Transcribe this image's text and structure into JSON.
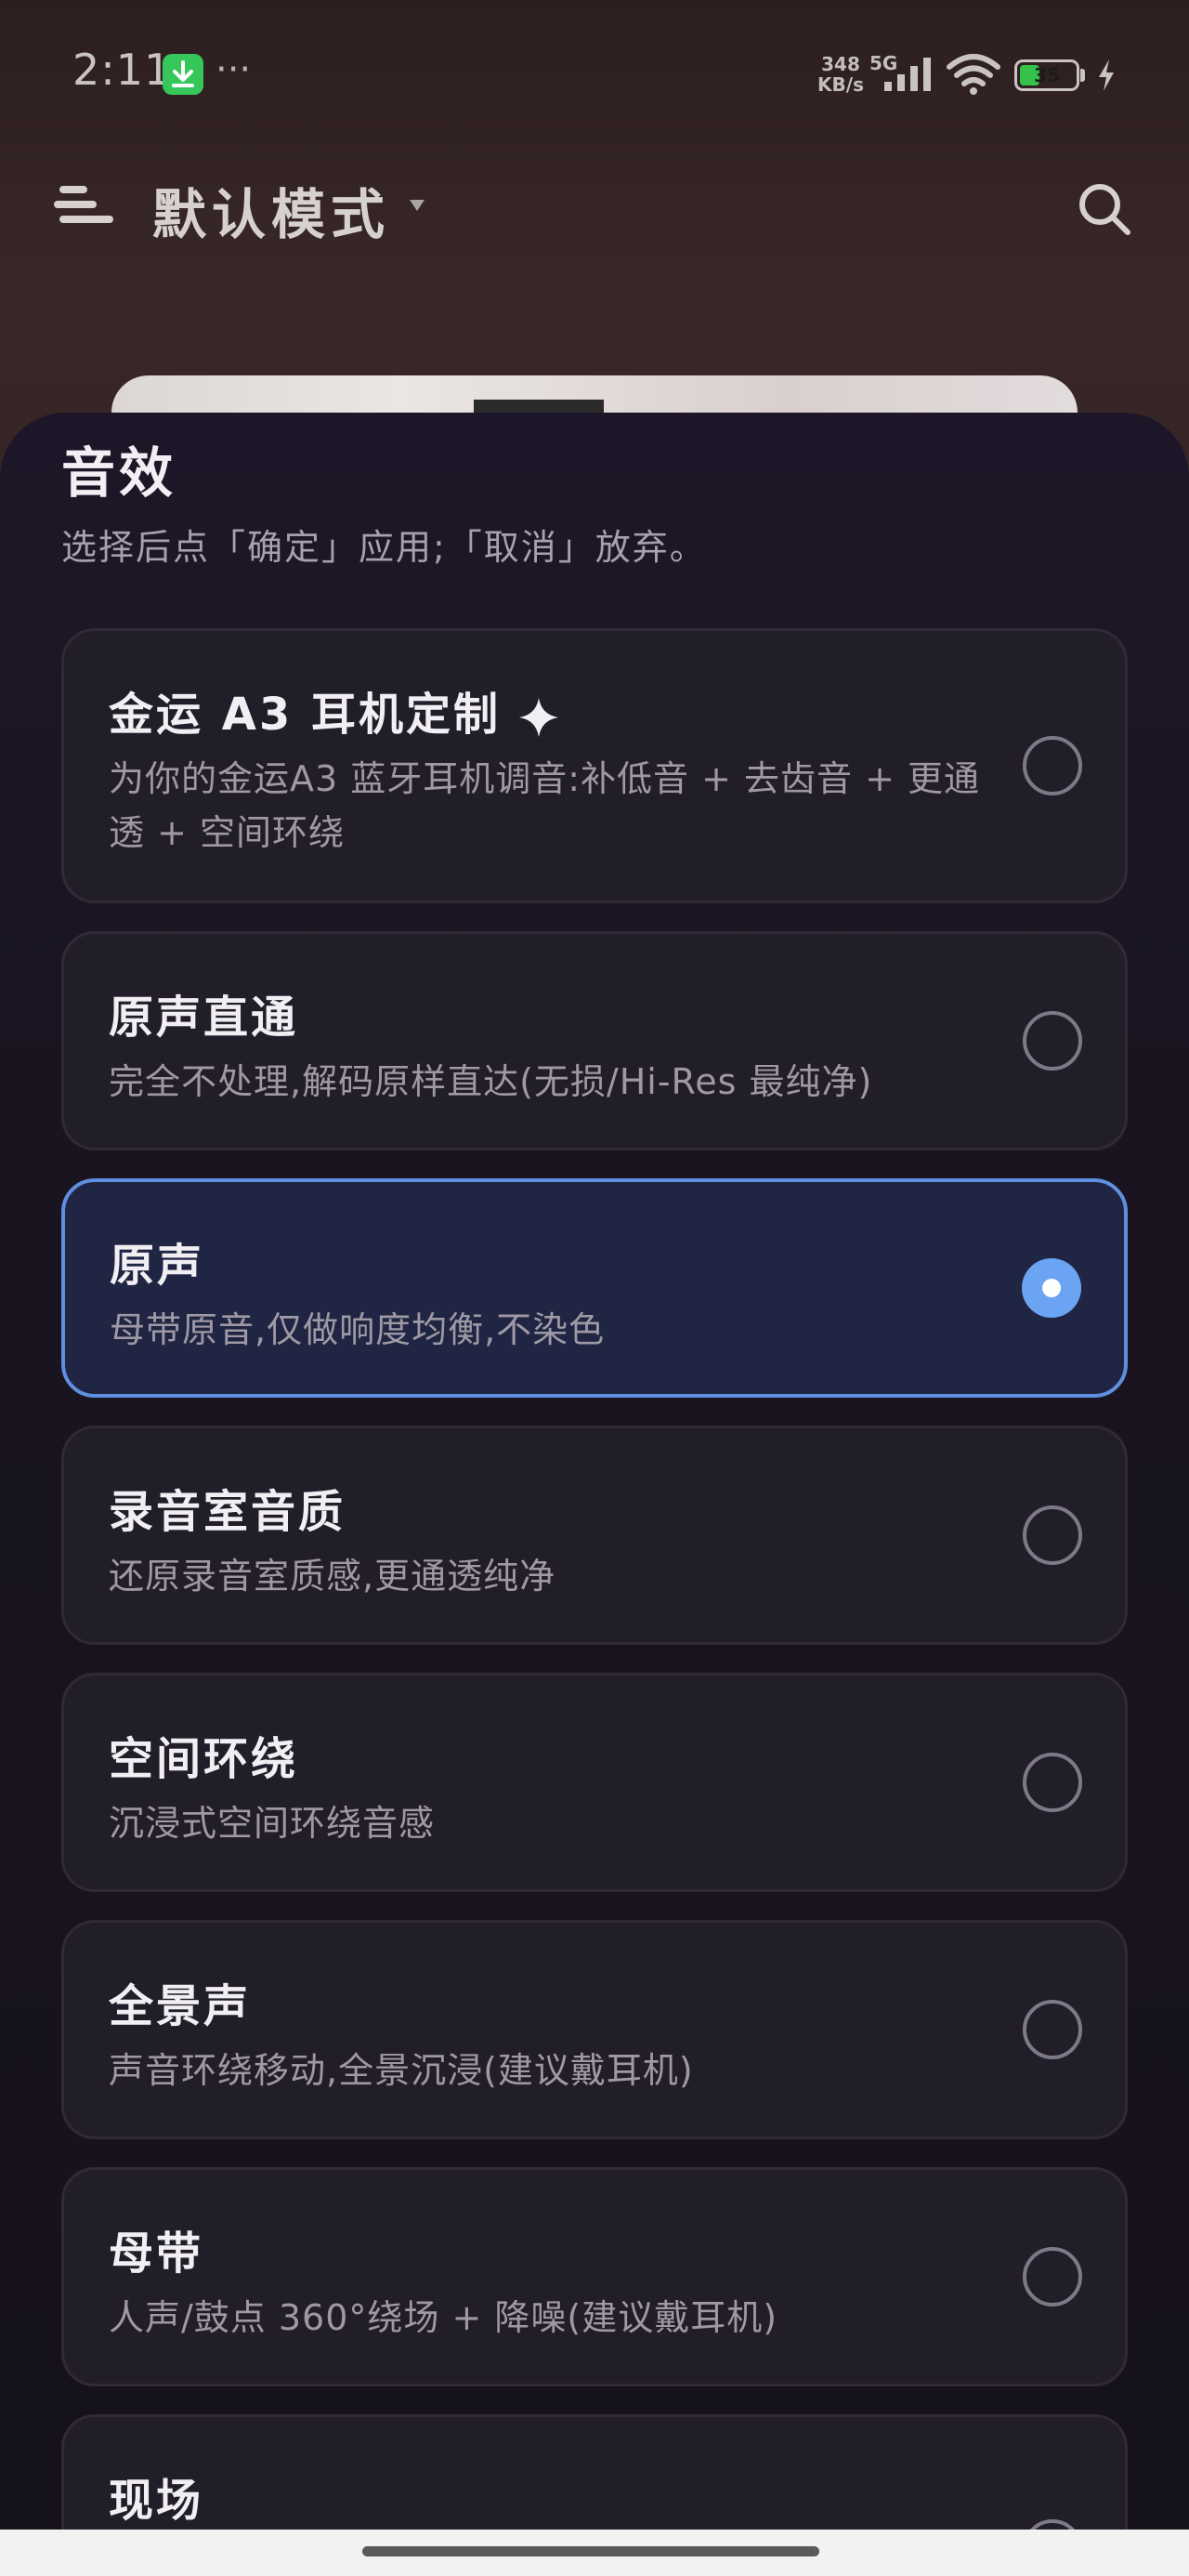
{
  "status_bar": {
    "time": "2:11",
    "more": "···",
    "net_speed_value": "348",
    "net_speed_unit": "KB/s",
    "network": "5G",
    "battery_level": "35",
    "icons": [
      "download-badge-icon",
      "signal-icon",
      "wifi-icon",
      "battery-icon",
      "charging-bolt-icon"
    ]
  },
  "header": {
    "mode_label": "默认模式",
    "icons": [
      "menu-icon",
      "dropdown-caret-icon",
      "search-icon"
    ]
  },
  "sheet": {
    "title": "音效",
    "subtitle": "选择后点「确定」应用;「取消」放弃。",
    "options": [
      {
        "title": "金运 A3 耳机定制",
        "desc": "为你的金运A3 蓝牙耳机调音:补低音 + 去齿音 + 更通透 + 空间环绕",
        "selected": false,
        "badge_icon": "sparkle-icon"
      },
      {
        "title": "原声直通",
        "desc": "完全不处理,解码原样直达(无损/Hi-Res 最纯净)",
        "selected": false
      },
      {
        "title": "原声",
        "desc": "母带原音,仅做响度均衡,不染色",
        "selected": true
      },
      {
        "title": "录音室音质",
        "desc": "还原录音室质感,更通透纯净",
        "selected": false
      },
      {
        "title": "空间环绕",
        "desc": "沉浸式空间环绕音感",
        "selected": false
      },
      {
        "title": "全景声",
        "desc": "声音环绕移动,全景沉浸(建议戴耳机)",
        "selected": false
      },
      {
        "title": "母带",
        "desc": "人声/鼓点 360°绕场 + 降噪(建议戴耳机)",
        "selected": false
      },
      {
        "title": "现场",
        "desc": "",
        "selected": false
      }
    ]
  },
  "colors": {
    "accent": "#6aa4f2",
    "selected_border": "#5f8fe0",
    "sheet_bg": "#19141f",
    "card_bg": "#221e29"
  }
}
